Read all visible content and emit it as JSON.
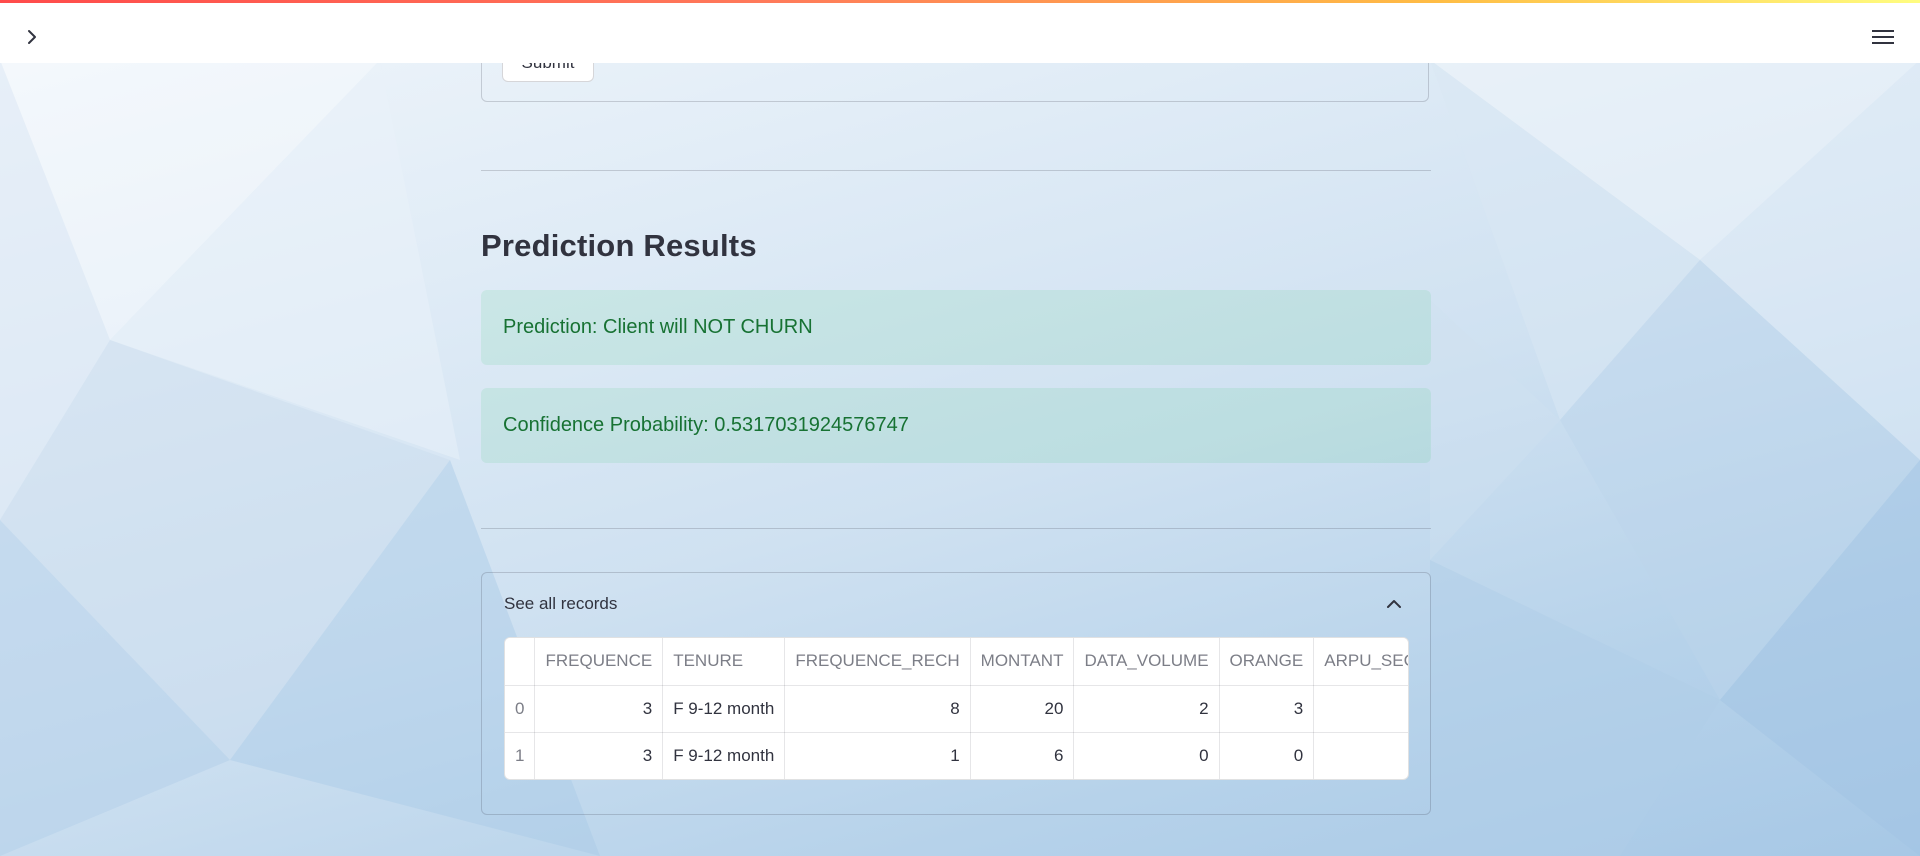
{
  "form": {
    "submit_label": "Submit"
  },
  "results": {
    "heading": "Prediction Results",
    "prediction_text": "Prediction: Client will NOT CHURN",
    "confidence_text": "Confidence Probability: 0.5317031924576747"
  },
  "records": {
    "expander_label": "See all records",
    "columns": [
      "",
      "FREQUENCE",
      "TENURE",
      "FREQUENCE_RECH",
      "MONTANT",
      "DATA_VOLUME",
      "ORANGE",
      "ARPU_SEG"
    ],
    "rows": [
      [
        "0",
        "3",
        "F 9-12 month",
        "8",
        "20",
        "2",
        "3",
        ""
      ],
      [
        "1",
        "3",
        "F 9-12 month",
        "1",
        "6",
        "0",
        "0",
        ""
      ]
    ]
  },
  "icons": {
    "sidebar_toggle": "chevron-right-icon",
    "main_menu": "hamburger-menu-icon",
    "expander_toggle": "chevron-up-icon"
  },
  "colors": {
    "success_text": "#177233",
    "success_bg": "rgba(33,195,84,0.1)",
    "accent_gradient_start": "#ff4b4b",
    "accent_gradient_end": "#fffd80"
  }
}
